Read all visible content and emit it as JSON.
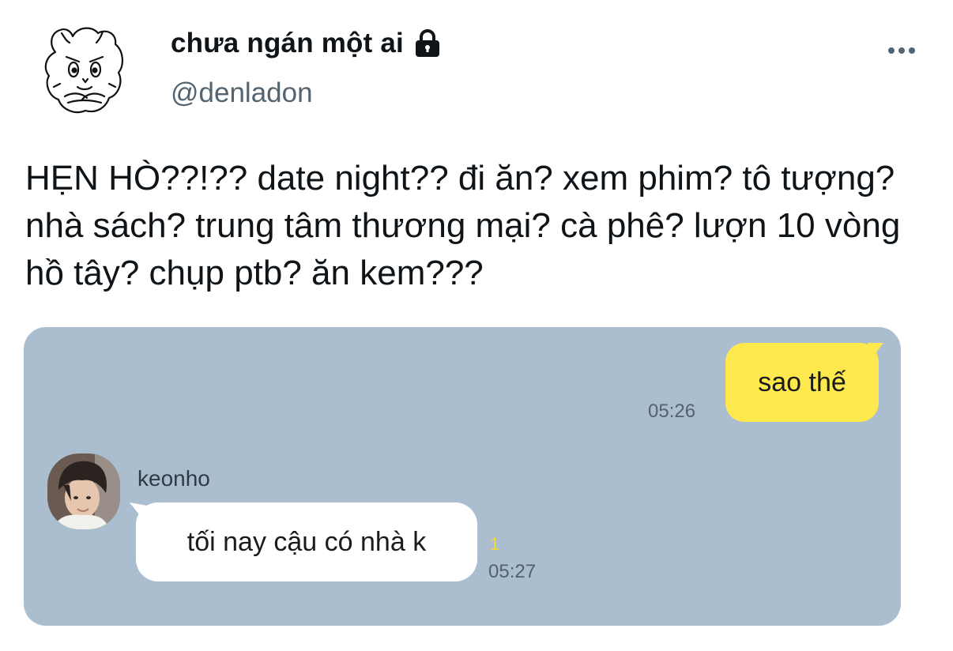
{
  "author": {
    "display_name": "chưa ngán một ai",
    "handle": "@denladon",
    "avatar_icon": "cartoon-hamster-avatar-icon",
    "protected_icon": "lock-icon"
  },
  "menu": {
    "more_icon": "more-horizontal-icon"
  },
  "tweet": {
    "text": "HẸN HÒ??!?? date night?? đi ăn? xem phim? tô tượng? nhà sách? trung tâm thương mại? cà phê? lượn 10 vòng hồ tây? chụp ptb? ăn kem???"
  },
  "chat": {
    "background_color": "#abbed0",
    "outgoing": {
      "text": "sao thế",
      "time": "05:26",
      "bubble_color": "#fde84d"
    },
    "incoming": {
      "sender": "keonho",
      "text": "tối nay cậu có nhà k",
      "unread": "1",
      "time": "05:27",
      "bubble_color": "#ffffff"
    }
  }
}
